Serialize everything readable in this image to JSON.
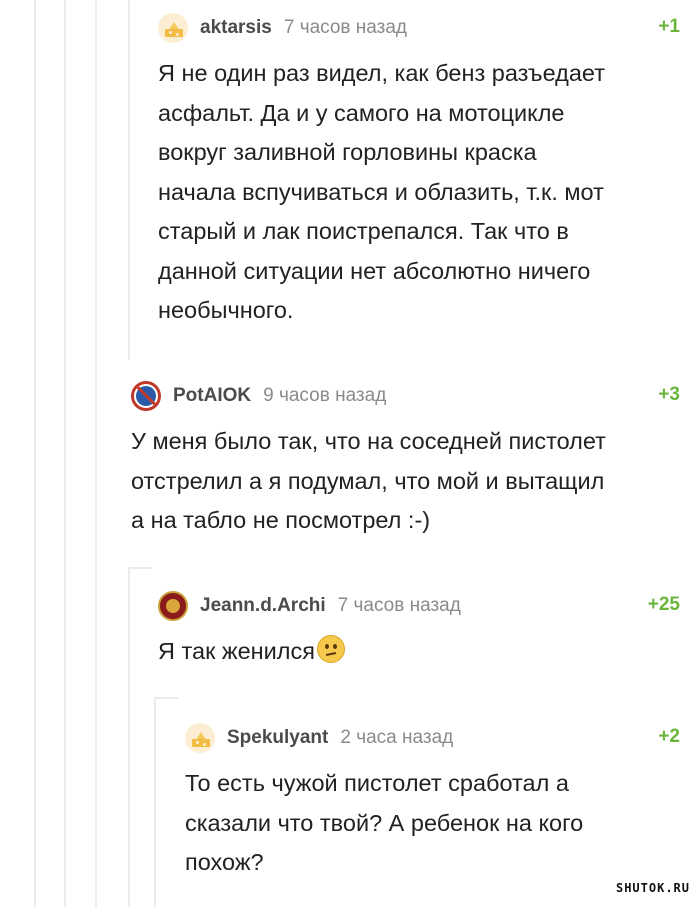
{
  "comments": [
    {
      "username": "aktarsis",
      "time": "7 часов назад",
      "rating": "+1",
      "avatar": "cheese-avatar",
      "lines": [
        "Я не один раз видел, как бенз разъедает",
        "асфальт. Да и у самого на мотоцикле",
        "вокруг заливной горловины краска",
        "начала вспучиваться и облазить, т.к. мот",
        "старый и лак поистрепался. Так что в",
        "данной ситуации нет абсолютно ничего",
        "необычного."
      ]
    },
    {
      "username": "PotAIOK",
      "time": "9 часов назад",
      "rating": "+3",
      "avatar": "no-parking-avatar",
      "lines": [
        "У меня было так, что на соседней пистолет",
        "отстрелил а я подумал, что мой и вытащил",
        "а на табло не посмотрел :-)"
      ]
    },
    {
      "username": "Jeann.d.Archi",
      "time": "7 часов назад",
      "rating": "+25",
      "avatar": "emblem-avatar",
      "lines": [
        "Я так женился"
      ],
      "emoji": "confused-face-emoji"
    },
    {
      "username": "Spekulyant",
      "time": "2 часа назад",
      "rating": "+2",
      "avatar": "cheese-avatar",
      "lines": [
        "То есть чужой пистолет сработал а",
        "сказали что твой? А ребенок на кого",
        "похож?"
      ]
    }
  ],
  "watermark": "SHUTOK.RU",
  "colors": {
    "rating": "#6bb53b",
    "thread_line": "#ececec",
    "username": "#4b4b4b",
    "time": "#8a8a8a"
  }
}
